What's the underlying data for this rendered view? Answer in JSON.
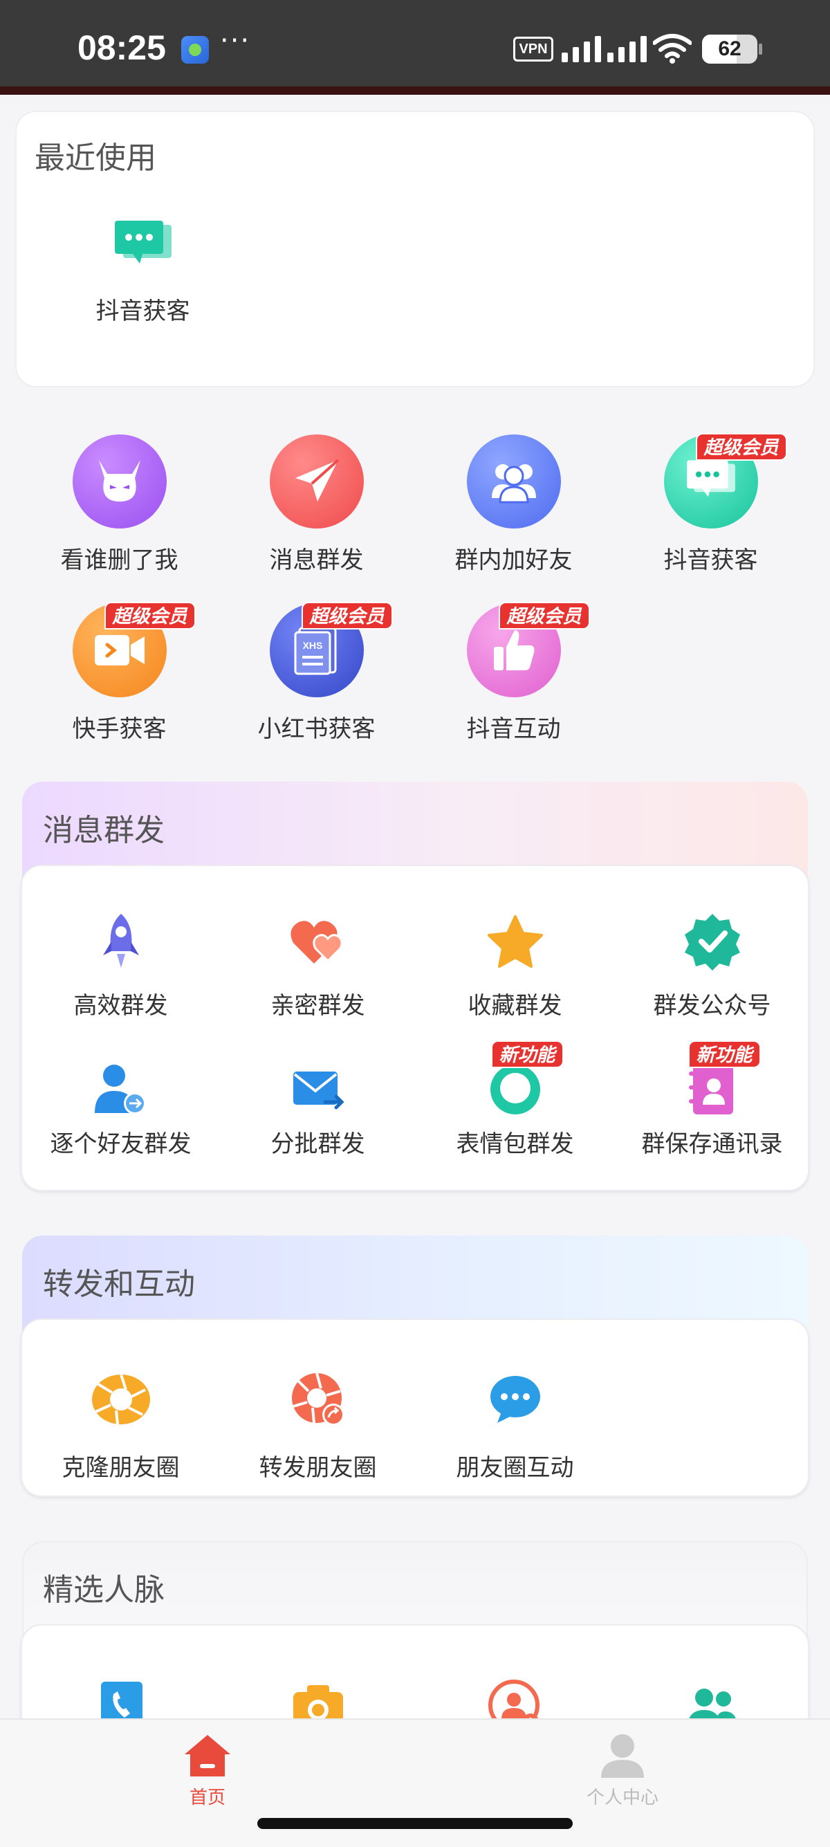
{
  "status_bar": {
    "time": "08:25",
    "more": "···",
    "vpn": "VPN",
    "battery": "62",
    "battery_level": 62
  },
  "recent": {
    "title": "最近使用",
    "items": [
      {
        "label": "抖音获客",
        "icon": "chat-bubbles-icon",
        "color": "#1ec8a5"
      }
    ]
  },
  "grid": {
    "badge_text": "超级会员",
    "items": [
      {
        "label": "看谁删了我",
        "icon": "devil-face-icon",
        "color": "#a55cf0"
      },
      {
        "label": "消息群发",
        "icon": "paper-plane-icon",
        "color": "#f25f5f"
      },
      {
        "label": "群内加好友",
        "icon": "group-users-icon",
        "color": "#5b7cf5"
      },
      {
        "label": "抖音获客",
        "icon": "chat-bubbles-icon",
        "color": "#1ec8a5",
        "badge": "超级会员"
      },
      {
        "label": "快手获客",
        "icon": "video-camera-icon",
        "color": "#f5952c",
        "badge": "超级会员"
      },
      {
        "label": "小红书获客",
        "icon": "xhs-book-icon",
        "color": "#4a5ce0",
        "badge": "超级会员",
        "icon_text": "XHS"
      },
      {
        "label": "抖音互动",
        "icon": "thumbs-up-icon",
        "color": "#e97bd6",
        "badge": "超级会员"
      }
    ]
  },
  "mass_message": {
    "title": "消息群发",
    "badge_text": "新功能",
    "items": [
      {
        "label": "高效群发",
        "icon": "rocket-icon",
        "color": "#6b6ee8"
      },
      {
        "label": "亲密群发",
        "icon": "hearts-icon",
        "color": "#f36a4f"
      },
      {
        "label": "收藏群发",
        "icon": "star-icon",
        "color": "#f7a928"
      },
      {
        "label": "群发公众号",
        "icon": "verified-badge-icon",
        "color": "#20b89a"
      },
      {
        "label": "逐个好友群发",
        "icon": "user-arrow-icon",
        "color": "#2a8de6"
      },
      {
        "label": "分批群发",
        "icon": "mail-forward-icon",
        "color": "#2a8de6"
      },
      {
        "label": "表情包群发",
        "icon": "smile-icon",
        "color": "#1ec8a5",
        "badge": "新功能"
      },
      {
        "label": "群保存通讯录",
        "icon": "contacts-book-icon",
        "color": "#e060d0",
        "badge": "新功能"
      }
    ]
  },
  "forward": {
    "title": "转发和互动",
    "items": [
      {
        "label": "克隆朋友圈",
        "icon": "aperture-icon",
        "color": "#f7a928"
      },
      {
        "label": "转发朋友圈",
        "icon": "aperture-share-icon",
        "color": "#f36a4f"
      },
      {
        "label": "朋友圈互动",
        "icon": "chat-dots-icon",
        "color": "#2a9de6"
      }
    ]
  },
  "contacts": {
    "title": "精选人脉",
    "items": [
      {
        "icon": "phone-book-icon",
        "color": "#2a9de6"
      },
      {
        "icon": "camera-icon",
        "color": "#f7a928"
      },
      {
        "icon": "user-add-icon",
        "color": "#f36a4f"
      },
      {
        "icon": "people-icon",
        "color": "#20b89a"
      }
    ]
  },
  "bottom_nav": {
    "home": "首页",
    "profile": "个人中心",
    "active_color": "#e84a3c",
    "inactive_color": "#bbbbbb"
  }
}
